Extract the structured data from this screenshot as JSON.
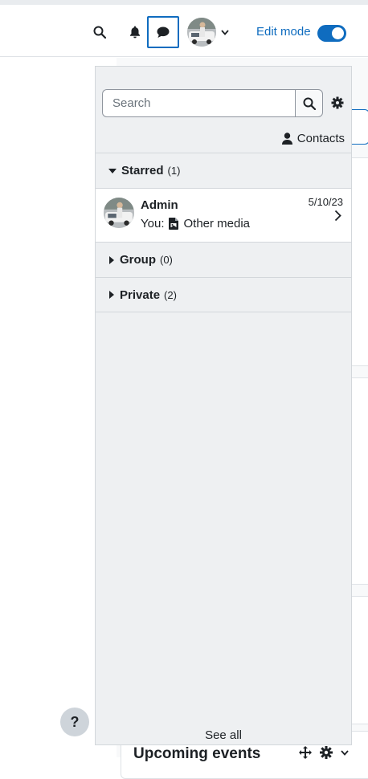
{
  "navbar": {
    "edit_mode_label": "Edit mode",
    "edit_mode_on": true
  },
  "messages_drawer": {
    "search_placeholder": "Search",
    "contacts_label": "Contacts",
    "sections": {
      "starred": {
        "label": "Starred",
        "count": "(1)",
        "expanded": true
      },
      "group": {
        "label": "Group",
        "count": "(0)",
        "expanded": false
      },
      "private": {
        "label": "Private",
        "count": "(2)",
        "expanded": false
      }
    },
    "conversations": [
      {
        "name": "Admin",
        "date": "5/10/23",
        "prefix": "You:",
        "preview": "Other media"
      }
    ],
    "see_all_label": "See all"
  },
  "background": {
    "block_title": "Upcoming events"
  },
  "help_label": "?",
  "colors": {
    "accent": "#0f6cbf",
    "drawer_bg": "#eef0f2",
    "text": "#1d2125"
  }
}
